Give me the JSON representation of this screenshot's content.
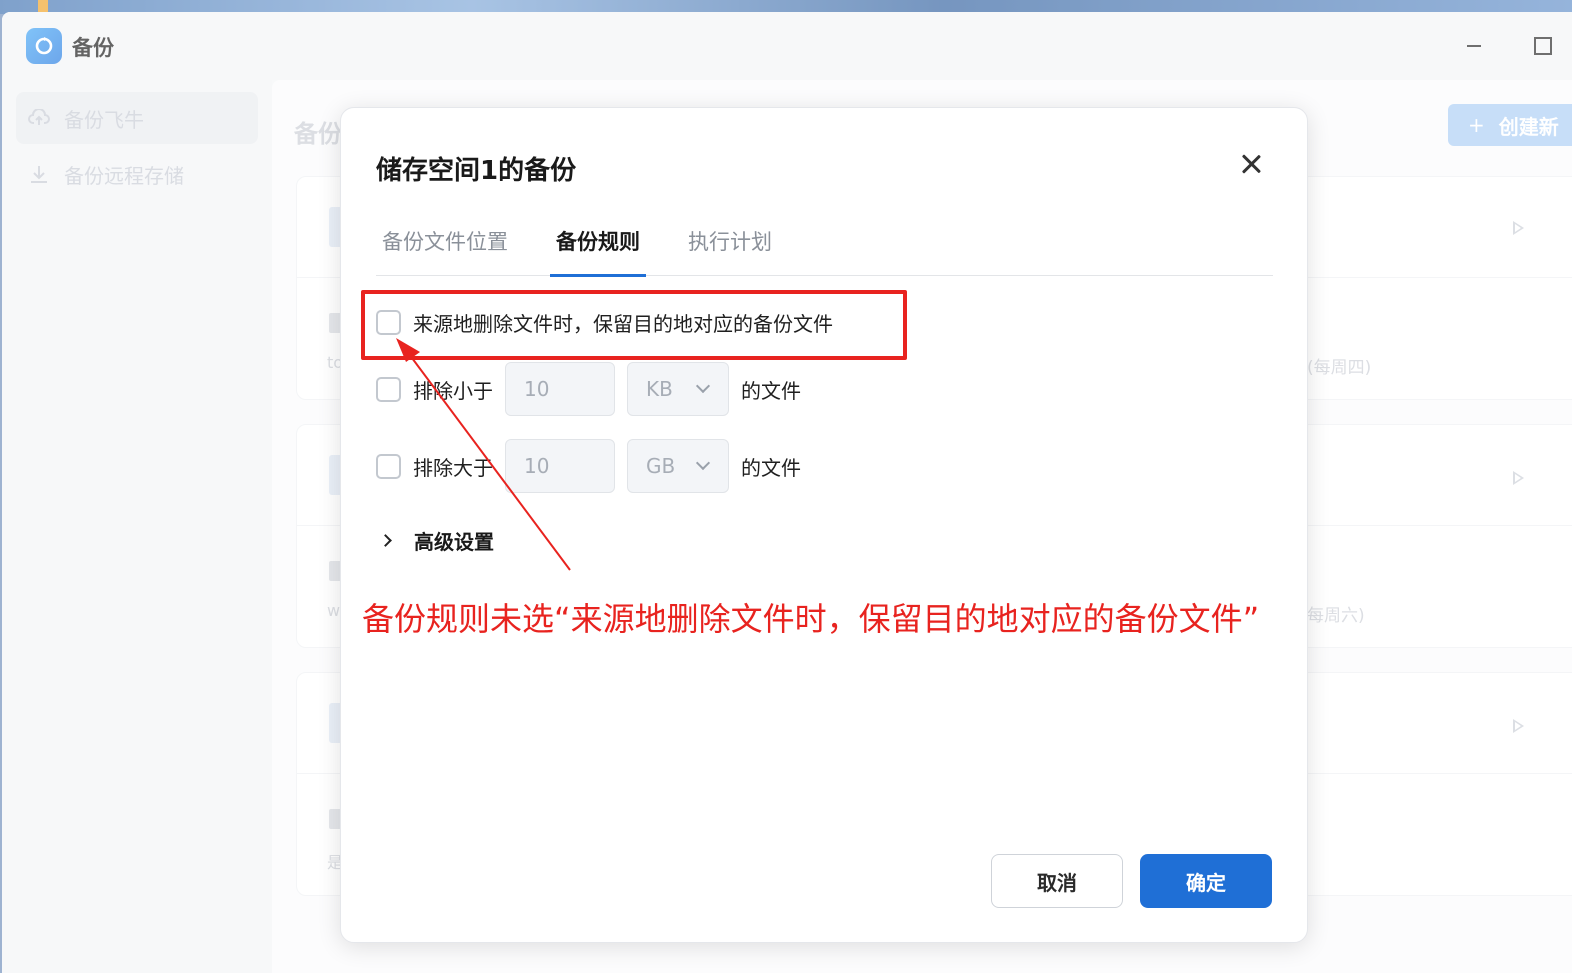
{
  "window": {
    "title": "备份"
  },
  "sidebar": {
    "items": [
      {
        "label": "备份飞牛"
      },
      {
        "label": "备份远程存储"
      }
    ]
  },
  "main": {
    "title": "备份",
    "create_button": "创建新",
    "cards": [
      {
        "schedule": "(每周四)",
        "sub": "to"
      },
      {
        "schedule": "每周六)",
        "sub": "w"
      },
      {
        "schedule": "",
        "sub": "是"
      }
    ]
  },
  "dialog": {
    "title": "储存空间1的备份",
    "tabs": [
      {
        "label": "备份文件位置"
      },
      {
        "label": "备份规则"
      },
      {
        "label": "执行计划"
      }
    ],
    "active_tab": "备份规则",
    "rules": {
      "keep_deleted_label": "来源地删除文件时，保留目的地对应的备份文件",
      "keep_deleted_checked": false,
      "exclude_smaller_label": "排除小于",
      "exclude_smaller_value": "10",
      "exclude_smaller_unit": "KB",
      "exclude_smaller_suffix": "的文件",
      "exclude_smaller_checked": false,
      "exclude_larger_label": "排除大于",
      "exclude_larger_value": "10",
      "exclude_larger_unit": "GB",
      "exclude_larger_suffix": "的文件",
      "exclude_larger_checked": false
    },
    "advanced_label": "高级设置",
    "cancel_label": "取消",
    "ok_label": "确定"
  },
  "annotation": {
    "text": "备份规则未选“来源地删除文件时，保留目的地对应的备份文件”",
    "color": "#e8231f"
  },
  "colors": {
    "primary": "#1f6fd6",
    "annotation": "#e8231f"
  }
}
